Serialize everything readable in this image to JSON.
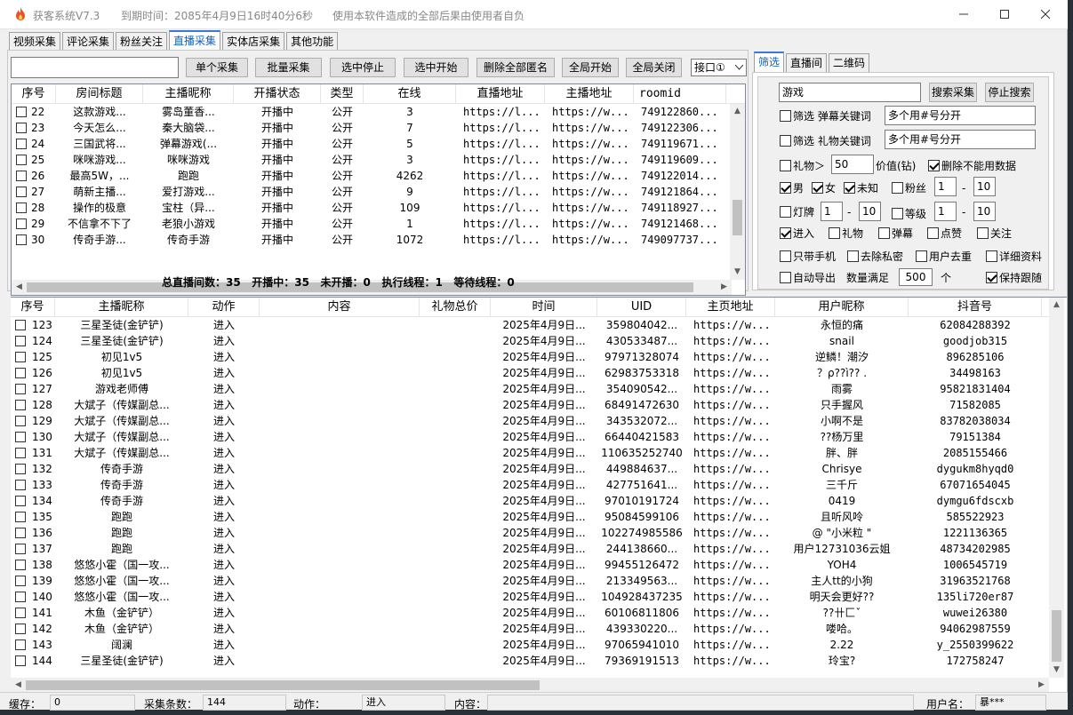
{
  "app": {
    "title": "获客系统V7.3",
    "expire": "到期时间：2085年4月9日16时40分6秒",
    "disclaimer": "使用本软件造成的全部后果由使用者自负"
  },
  "tabs": [
    "视频采集",
    "评论采集",
    "粉丝关注",
    "直播采集",
    "实体店采集",
    "其他功能"
  ],
  "toolbar": {
    "search_value": "",
    "buttons": [
      "单个采集",
      "批量采集",
      "选中停止",
      "选中开始",
      "删除全部匿名",
      "全局开始",
      "全局关闭"
    ],
    "port": "接口①"
  },
  "rooms": {
    "headers": [
      "序号",
      "房间标题",
      "主播昵称",
      "开播状态",
      "类型",
      "在线",
      "直播地址",
      "主播地址",
      "roomid"
    ],
    "rows": [
      [
        "22",
        "这款游戏...",
        "雾岛董香...",
        "开播中",
        "公开",
        "3",
        "https://l...",
        "https://w...",
        "749122860..."
      ],
      [
        "23",
        "今天怎么...",
        "秦大脑袋...",
        "开播中",
        "公开",
        "7",
        "https://l...",
        "https://w...",
        "749122306..."
      ],
      [
        "24",
        "三国武将...",
        "弹幕游戏(...",
        "开播中",
        "公开",
        "5",
        "https://l...",
        "https://w...",
        "749119671..."
      ],
      [
        "25",
        "咪咪游戏...",
        "咪咪游戏",
        "开播中",
        "公开",
        "3",
        "https://l...",
        "https://w...",
        "749119609..."
      ],
      [
        "26",
        "最高5W，...",
        "跑跑",
        "开播中",
        "公开",
        "4262",
        "https://l...",
        "https://w...",
        "749122014..."
      ],
      [
        "27",
        "萌新主播...",
        "爱打游戏...",
        "开播中",
        "公开",
        "9",
        "https://l...",
        "https://w...",
        "749121864..."
      ],
      [
        "28",
        "操作的极意",
        "宝柱（异...",
        "开播中",
        "公开",
        "109",
        "https://l...",
        "https://w...",
        "749118927..."
      ],
      [
        "29",
        "不信拿不下了",
        "老狼小游戏",
        "开播中",
        "公开",
        "1",
        "https://l...",
        "https://w...",
        "749121468..."
      ],
      [
        "30",
        "传奇手游...",
        "传奇手游",
        "开播中",
        "公开",
        "1072",
        "https://l...",
        "https://w...",
        "749097737..."
      ]
    ]
  },
  "stats": {
    "total_label": "总直播间数：",
    "total": "35",
    "live_label": "开播中：",
    "live": "35",
    "off_label": "未开播：",
    "off": "0",
    "exec_label": "执行线程：",
    "exec": "1",
    "wait_label": "等待线程：",
    "wait": "0"
  },
  "filter": {
    "tabs": [
      "筛选",
      "直播间",
      "二维码"
    ],
    "keyword": "游戏",
    "search_btn": "搜索采集",
    "stop_btn": "停止搜索",
    "danmu_label": "筛选 弹幕关键词",
    "danmu_value": "多个用#号分开",
    "gift_label": "筛选 礼物关键词",
    "gift_value": "多个用#号分开",
    "gift_gt_label": "礼物＞",
    "gift_gt_value": "50",
    "value_unit": "价值(钻)",
    "delete_invalid": "删除不能用数据",
    "male": "男",
    "female": "女",
    "unknown": "未知",
    "fans": "粉丝",
    "fans_min": "1",
    "fans_max": "10",
    "dash": "-",
    "lamp": "灯牌",
    "lamp_min": "1",
    "lamp_max": "10",
    "level": "等级",
    "level_min": "1",
    "level_max": "10",
    "enter": "进入",
    "gift": "礼物",
    "danmu": "弹幕",
    "like": "点赞",
    "follow": "关注",
    "phone_only": "只带手机",
    "remove_private": "去除私密",
    "user_dedup": "用户去重",
    "detail": "详细资料",
    "auto_export": "自动导出",
    "count_label": "数量满足",
    "count_value": "500",
    "count_unit": "个",
    "keep_follow": "保持跟随"
  },
  "users": {
    "headers": [
      "序号",
      "主播昵称",
      "动作",
      "内容",
      "礼物总价",
      "时间",
      "UID",
      "主页地址",
      "用户昵称",
      "抖音号"
    ],
    "rows": [
      [
        "123",
        "三星圣徒(金铲铲)",
        "进入",
        "",
        "",
        "2025年4月9日...",
        "359804042...",
        "https://w...",
        "永恒的痛",
        "62084288392"
      ],
      [
        "124",
        "三星圣徒(金铲铲)",
        "进入",
        "",
        "",
        "2025年4月9日...",
        "430533487...",
        "https://w...",
        "snail",
        "goodjob315"
      ],
      [
        "125",
        "初见1v5",
        "进入",
        "",
        "",
        "2025年4月9日...",
        "97971328074",
        "https://w...",
        "逆鳞！潮汐",
        "896285106"
      ],
      [
        "126",
        "初见1v5",
        "进入",
        "",
        "",
        "2025年4月9日...",
        "62983753318",
        "https://w...",
        "？ρ??ì?? .",
        "34498163"
      ],
      [
        "127",
        "游戏老师傅",
        "进入",
        "",
        "",
        "2025年4月9日...",
        "354090542...",
        "https://w...",
        "雨雾",
        "95821831404"
      ],
      [
        "128",
        "大斌子（传媒副总...",
        "进入",
        "",
        "",
        "2025年4月9日...",
        "68491472630",
        "https://w...",
        "只手握风",
        "71582085"
      ],
      [
        "129",
        "大斌子（传媒副总...",
        "进入",
        "",
        "",
        "2025年4月9日...",
        "343532072...",
        "https://w...",
        "小啊不是",
        "83782038034"
      ],
      [
        "130",
        "大斌子（传媒副总...",
        "进入",
        "",
        "",
        "2025年4月9日...",
        "66440421583",
        "https://w...",
        "??杨万里",
        "79151384"
      ],
      [
        "131",
        "大斌子（传媒副总...",
        "进入",
        "",
        "",
        "2025年4月9日...",
        "110635252740",
        "https://w...",
        "胖、胖",
        "2085155466"
      ],
      [
        "132",
        "传奇手游",
        "进入",
        "",
        "",
        "2025年4月9日...",
        "449884637...",
        "https://w...",
        "Chrisye",
        "dygukm8hyqd0"
      ],
      [
        "133",
        "传奇手游",
        "进入",
        "",
        "",
        "2025年4月9日...",
        "427751641...",
        "https://w...",
        "三千斤",
        "67071654045"
      ],
      [
        "134",
        "传奇手游",
        "进入",
        "",
        "",
        "2025年4月9日...",
        "97010191724",
        "https://w...",
        "0419",
        "dymgu6fdscxb"
      ],
      [
        "135",
        "跑跑",
        "进入",
        "",
        "",
        "2025年4月9日...",
        "95084599106",
        "https://w...",
        "且听风呤",
        "585522923"
      ],
      [
        "136",
        "跑跑",
        "进入",
        "",
        "",
        "2025年4月9日...",
        "102274985586",
        "https://w...",
        "@ \"小米粒 \"",
        "1221136365"
      ],
      [
        "137",
        "跑跑",
        "进入",
        "",
        "",
        "2025年4月9日...",
        "244138660...",
        "https://w...",
        "用户12731036云姐",
        "48734202985"
      ],
      [
        "138",
        "悠悠小霍（国一攻...",
        "进入",
        "",
        "",
        "2025年4月9日...",
        "99455126472",
        "https://w...",
        "YOH4",
        "1006545719"
      ],
      [
        "139",
        "悠悠小霍（国一攻...",
        "进入",
        "",
        "",
        "2025年4月9日...",
        "213349563...",
        "https://w...",
        "主人tt的小狗",
        "31963521768"
      ],
      [
        "140",
        "悠悠小霍（国一攻...",
        "进入",
        "",
        "",
        "2025年4月9日...",
        "104928437235",
        "https://w...",
        "明天会更好??",
        "135li720er87"
      ],
      [
        "141",
        "木鱼（金铲铲）",
        "进入",
        "",
        "",
        "2025年4月9日...",
        "60106811806",
        "https://w...",
        "??卄匚ˇ",
        "wuwei26380"
      ],
      [
        "142",
        "木鱼（金铲铲）",
        "进入",
        "",
        "",
        "2025年4月9日...",
        "439330220...",
        "https://w...",
        "喽哈。",
        "94062987559"
      ],
      [
        "143",
        "阔澜",
        "进入",
        "",
        "",
        "2025年4月9日...",
        "97065941010",
        "https://w...",
        "2.22",
        "y_2550399622"
      ],
      [
        "144",
        "三星圣徒(金铲铲)",
        "进入",
        "",
        "",
        "2025年4月9日...",
        "79369191513",
        "https://w...",
        "玲宝?",
        "172758247"
      ]
    ]
  },
  "status": {
    "cache_label": "缓存：",
    "cache": "0",
    "count_label": "采集条数：",
    "count": "144",
    "action_label": "动作：",
    "action": "进入",
    "content_label": "内容：",
    "content": "",
    "user_label": "用户名：",
    "user": "暴***"
  }
}
